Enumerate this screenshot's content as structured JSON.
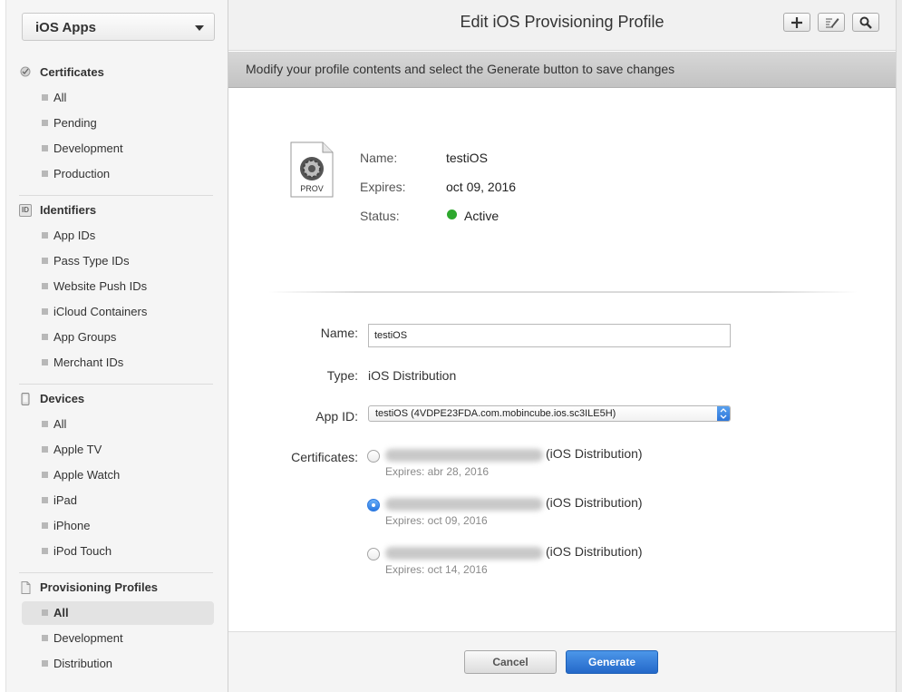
{
  "sidebar": {
    "platform": "iOS Apps",
    "sections": {
      "certificates": {
        "title": "Certificates",
        "items": [
          "All",
          "Pending",
          "Development",
          "Production"
        ]
      },
      "identifiers": {
        "title": "Identifiers",
        "icon_text": "ID",
        "items": [
          "App IDs",
          "Pass Type IDs",
          "Website Push IDs",
          "iCloud Containers",
          "App Groups",
          "Merchant IDs"
        ]
      },
      "devices": {
        "title": "Devices",
        "items": [
          "All",
          "Apple TV",
          "Apple Watch",
          "iPad",
          "iPhone",
          "iPod Touch"
        ]
      },
      "profiles": {
        "title": "Provisioning Profiles",
        "items": [
          "All",
          "Development",
          "Distribution"
        ],
        "active_item": "All"
      }
    }
  },
  "header": {
    "title": "Edit iOS Provisioning Profile",
    "buttons": [
      "add-icon",
      "edit-icon",
      "search-icon"
    ]
  },
  "banner": {
    "text": "Modify your profile contents and select the Generate button to save changes"
  },
  "summary": {
    "icon_label": "PROV",
    "name_label": "Name:",
    "name_value": "testiOS",
    "expires_label": "Expires:",
    "expires_value": "oct 09, 2016",
    "status_label": "Status:",
    "status_value": "Active",
    "status_color": "#2ea82e"
  },
  "form": {
    "name_label": "Name:",
    "name_value": "testiOS",
    "type_label": "Type:",
    "type_value": "iOS Distribution",
    "appid_label": "App ID:",
    "appid_value": "testiOS (4VDPE23FDA.com.mobincube.ios.sc3ILE5H)",
    "certificates_label": "Certificates:",
    "certificates": [
      {
        "type": "(iOS Distribution)",
        "expires": "Expires: abr 28, 2016",
        "selected": false
      },
      {
        "type": "(iOS Distribution)",
        "expires": "Expires: oct 09, 2016",
        "selected": true
      },
      {
        "type": "(iOS Distribution)",
        "expires": "Expires: oct 14, 2016",
        "selected": false
      }
    ]
  },
  "footer": {
    "cancel_label": "Cancel",
    "generate_label": "Generate"
  },
  "colors": {
    "accent": "#2a79e1",
    "active_status": "#2ea82e"
  }
}
